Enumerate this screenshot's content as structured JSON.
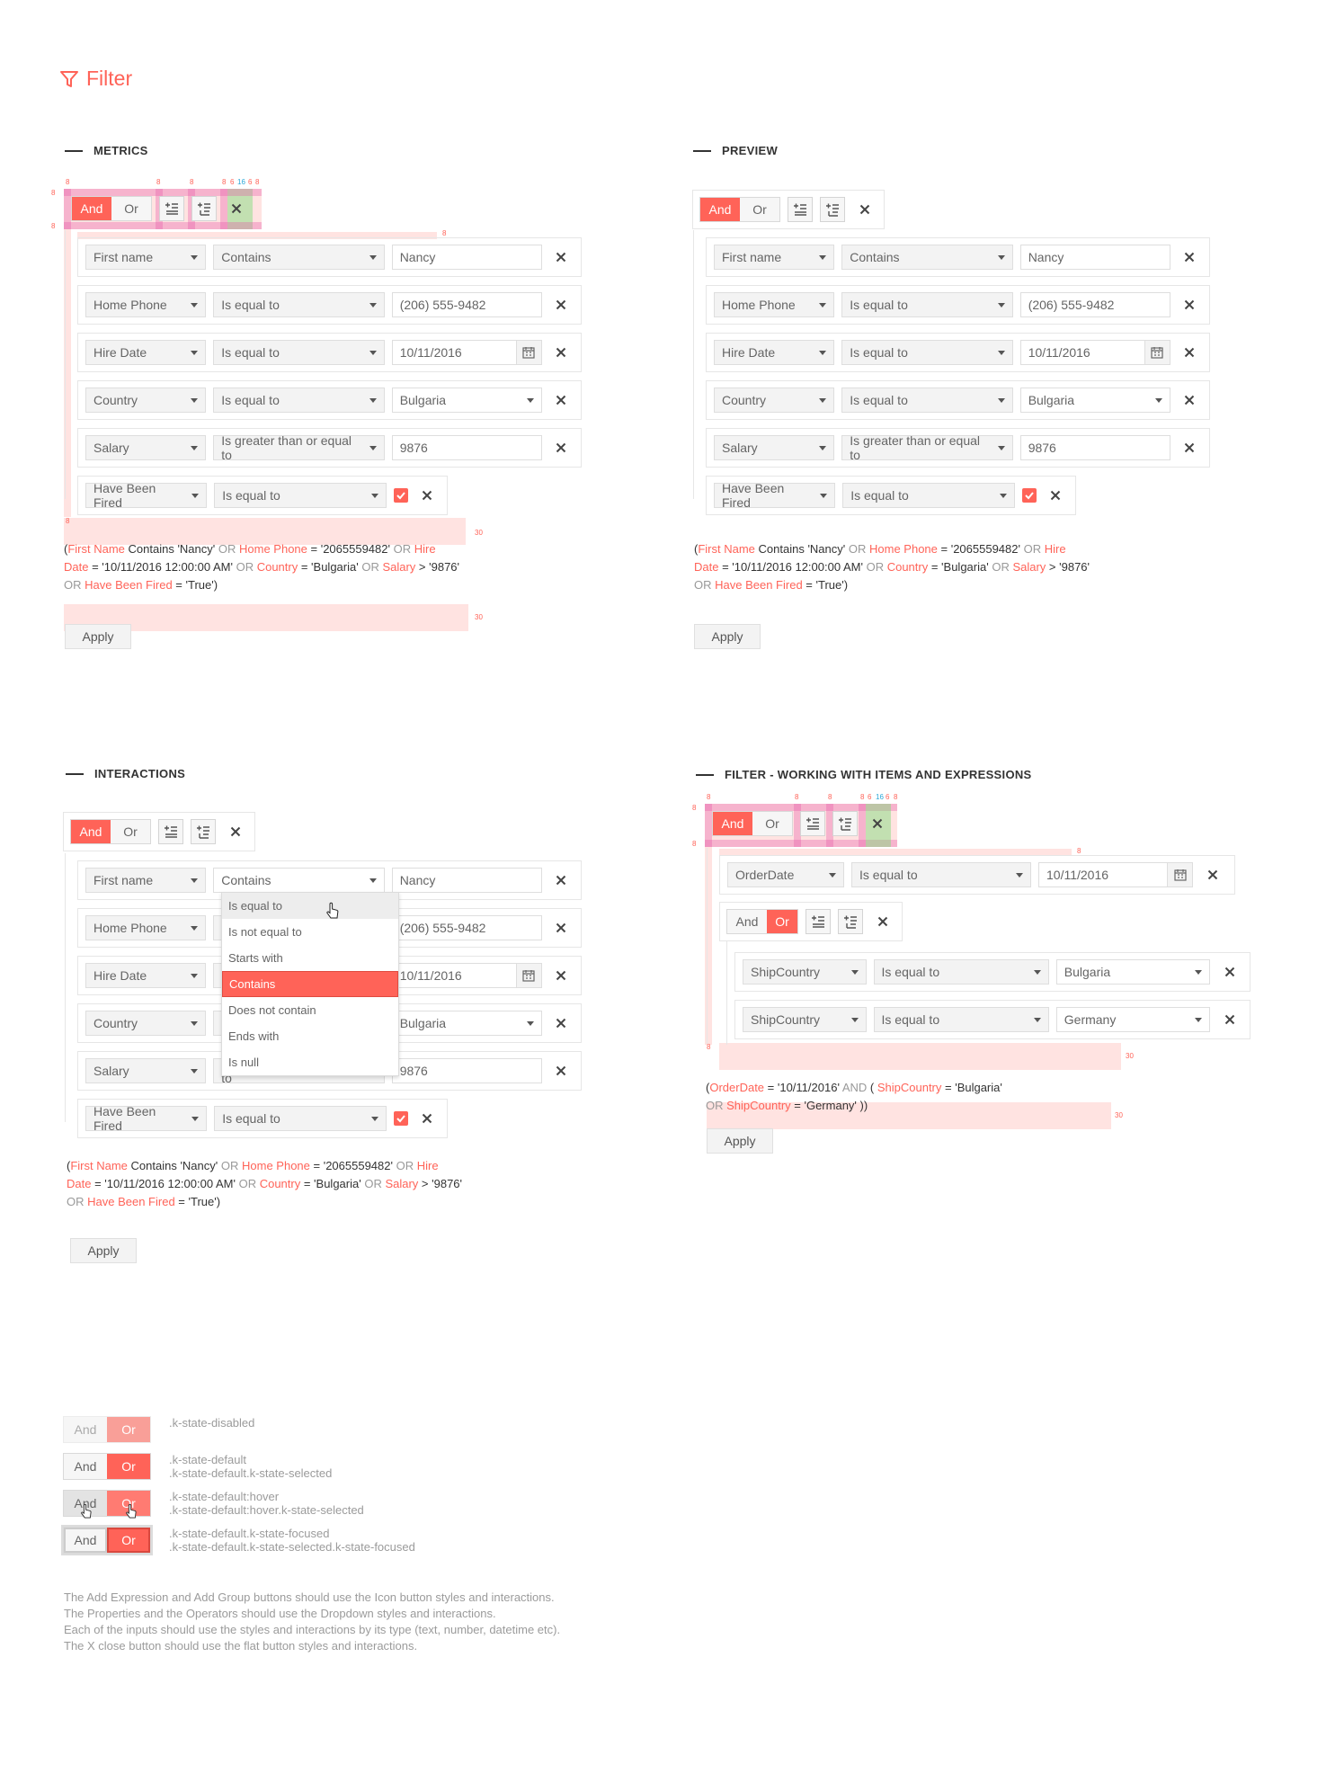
{
  "page_title": "Filter",
  "fields": [
    "First name",
    "Home Phone",
    "Hire Date",
    "Country",
    "Salary",
    "Have Been Fired"
  ],
  "operators": [
    "Contains",
    "Is equal to",
    "Is equal to",
    "Is equal to",
    "Is greater than or equal to",
    "Is equal to"
  ],
  "values": [
    "Nancy",
    "(206) 555-9482",
    "10/11/2016",
    "Bulgaria",
    "9876"
  ],
  "and_label": "And",
  "or_label": "Or",
  "apply_label": "Apply",
  "sections": {
    "metrics": "METRICS",
    "preview": "PREVIEW",
    "interactions": "INTERACTIONS",
    "items": "FILTER - WORKING WITH ITEMS AND EXPRESSIONS"
  },
  "expression": {
    "p1": "(",
    "f1": "First Name",
    "t1": " Contains 'Nancy' ",
    "or": "OR",
    "f2": "Home Phone",
    "t2": " = '2065559482' ",
    "f3a": "Hire",
    "f3b": "Date",
    "t3": " = '10/11/2016 12:00:00 AM' ",
    "f4": "Country",
    "t4": " = 'Bulgaria' ",
    "f5": "Salary",
    "t5": " > '9876'",
    "f6": "Have Been Fired",
    "t6": " = 'True')"
  },
  "dropdown_options": [
    "Is equal to",
    "Is not equal to",
    "Starts with",
    "Contains",
    "Does not contain",
    "Ends with",
    "Is null"
  ],
  "items_section": {
    "field1": "OrderDate",
    "op1": "Is equal to",
    "val1": "10/11/2016",
    "field2": "ShipCountry",
    "op2": "Is equal to",
    "val2": "Bulgaria",
    "field3": "ShipCountry",
    "op3": "Is equal to",
    "val3": "Germany",
    "expr": {
      "p": "(",
      "f1": "OrderDate",
      "t1": " = '10/11/2016' ",
      "and": "AND",
      "p2": " ( ",
      "f2": "ShipCountry",
      "t2": " = 'Bulgaria'",
      "or": "OR",
      "f3": "ShipCountry",
      "t3": " = 'Germany' ))"
    }
  },
  "measure": {
    "eight": "8",
    "six": "6",
    "sixteen": "16",
    "thirty": "30"
  },
  "states": [
    {
      "line1": ".k-state-disabled",
      "line2": ""
    },
    {
      "line1": ".k-state-default",
      "line2": ".k-state-default.k-state-selected"
    },
    {
      "line1": ".k-state-default:hover",
      "line2": ".k-state-default:hover.k-state-selected"
    },
    {
      "line1": ".k-state-default.k-state-focused",
      "line2": ".k-state-default.k-state-selected.k-state-focused"
    }
  ],
  "notes": [
    "The Add Expression and Add Group buttons should use the Icon button styles and interactions.",
    "The Properties and the Operators should use the Dropdown styles and interactions.",
    "Each of the inputs should use the styles and interactions by its type (text, number, datetime etc).",
    "The X close button should use the flat button styles and interactions."
  ],
  "colors": {
    "accent": "#ff6358",
    "text": "#656565",
    "muted": "#9b9b9b"
  }
}
